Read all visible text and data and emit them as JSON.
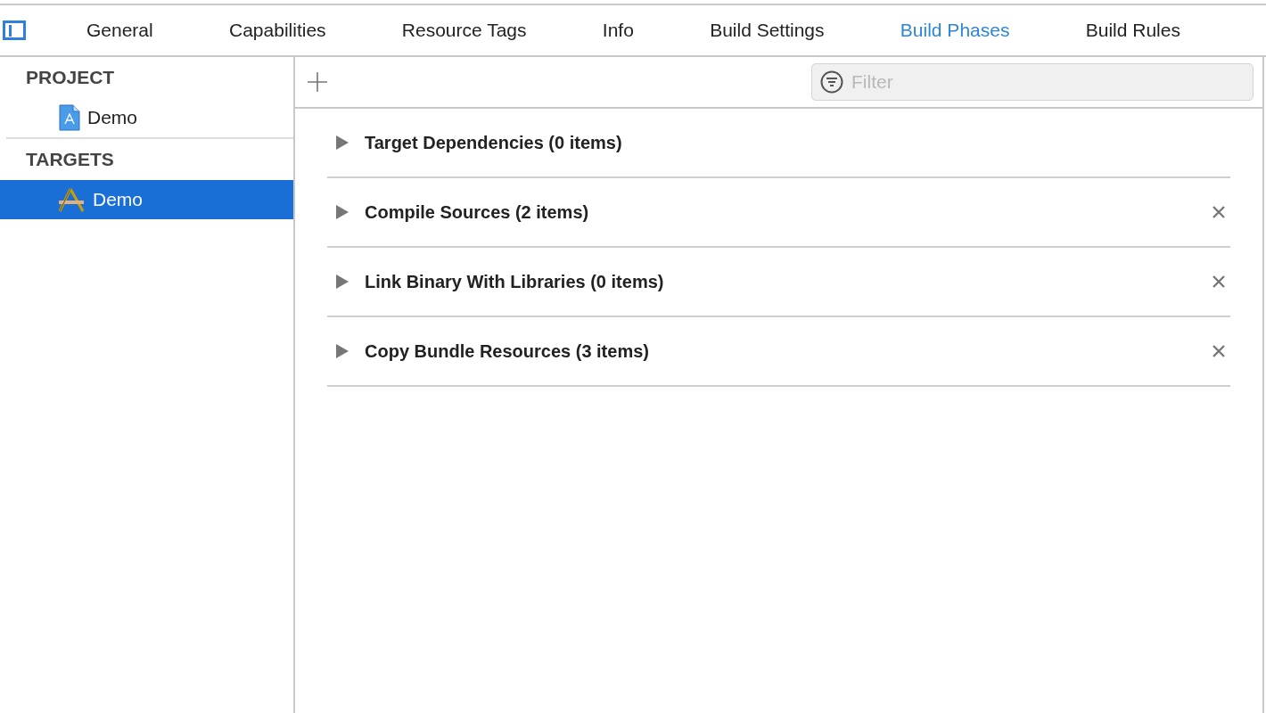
{
  "tabs": [
    {
      "label": "General",
      "selected": false
    },
    {
      "label": "Capabilities",
      "selected": false
    },
    {
      "label": "Resource Tags",
      "selected": false
    },
    {
      "label": "Info",
      "selected": false
    },
    {
      "label": "Build Settings",
      "selected": false
    },
    {
      "label": "Build Phases",
      "selected": true
    },
    {
      "label": "Build Rules",
      "selected": false
    }
  ],
  "sidebar": {
    "sections": [
      {
        "header": "PROJECT",
        "items": [
          {
            "label": "Demo",
            "kind": "project",
            "selected": false
          }
        ]
      },
      {
        "header": "TARGETS",
        "items": [
          {
            "label": "Demo",
            "kind": "target",
            "selected": true
          }
        ]
      }
    ]
  },
  "toolbar": {
    "filter": {
      "placeholder": "Filter"
    }
  },
  "phases": [
    {
      "title": "Target Dependencies (0 items)",
      "expanded": false,
      "removable": false
    },
    {
      "title": "Compile Sources (2 items)",
      "expanded": false,
      "removable": true
    },
    {
      "title": "Link Binary With Libraries (0 items)",
      "expanded": false,
      "removable": true
    },
    {
      "title": "Copy Bundle Resources (3 items)",
      "expanded": false,
      "removable": true
    }
  ]
}
